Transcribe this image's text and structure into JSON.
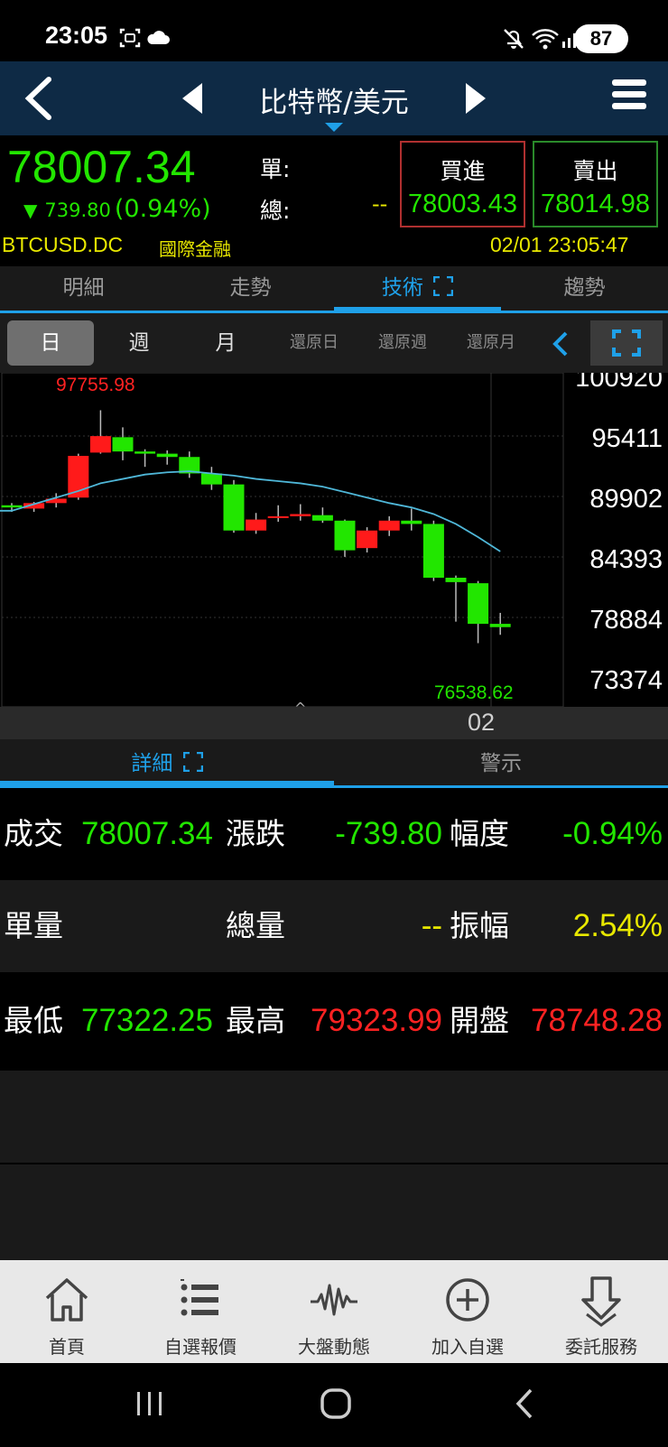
{
  "status_bar": {
    "time": "23:05",
    "battery": "87"
  },
  "header": {
    "title": "比特幣/美元"
  },
  "quote": {
    "last_price": "78007.34",
    "change_amount": "739.80",
    "change_percent": "(0.94%)",
    "unit_label": "單:",
    "total_label": "總:",
    "total_value": "--",
    "buy_label": "買進",
    "buy_price": "78003.43",
    "sell_label": "賣出",
    "sell_price": "78014.98",
    "symbol": "BTCUSD.DC",
    "exchange": "國際金融",
    "datetime": "02/01 23:05:47"
  },
  "tabs": [
    "明細",
    "走勢",
    "技術",
    "趨勢"
  ],
  "periods": [
    "日",
    "週",
    "月",
    "還原日",
    "還原週",
    "還原月"
  ],
  "chart_data": {
    "type": "candlestick",
    "y_ticks": [
      100920,
      95411,
      89902,
      84393,
      78884,
      73374
    ],
    "ylim": [
      73374,
      100920
    ],
    "high_label": "97755.98",
    "low_label": "76538.62",
    "x_label": "02",
    "candles": [
      {
        "o": 88900,
        "h": 89300,
        "l": 88500,
        "c": 89100,
        "color": "green"
      },
      {
        "o": 88800,
        "h": 89400,
        "l": 88500,
        "c": 89300,
        "color": "red"
      },
      {
        "o": 89300,
        "h": 90200,
        "l": 88900,
        "c": 89700,
        "color": "red"
      },
      {
        "o": 89800,
        "h": 93800,
        "l": 89600,
        "c": 93600,
        "color": "red"
      },
      {
        "o": 93900,
        "h": 97756,
        "l": 93800,
        "c": 95400,
        "color": "red"
      },
      {
        "o": 95300,
        "h": 96200,
        "l": 93200,
        "c": 94000,
        "color": "green"
      },
      {
        "o": 94000,
        "h": 94200,
        "l": 92600,
        "c": 93800,
        "color": "green"
      },
      {
        "o": 93800,
        "h": 94100,
        "l": 92800,
        "c": 93500,
        "color": "green"
      },
      {
        "o": 93500,
        "h": 94000,
        "l": 91600,
        "c": 92000,
        "color": "green"
      },
      {
        "o": 92000,
        "h": 92600,
        "l": 90500,
        "c": 91000,
        "color": "green"
      },
      {
        "o": 91000,
        "h": 91400,
        "l": 86600,
        "c": 86800,
        "color": "green"
      },
      {
        "o": 86800,
        "h": 88400,
        "l": 86500,
        "c": 87800,
        "color": "red"
      },
      {
        "o": 88000,
        "h": 89100,
        "l": 87600,
        "c": 88100,
        "color": "red"
      },
      {
        "o": 88100,
        "h": 89200,
        "l": 87700,
        "c": 88300,
        "color": "red"
      },
      {
        "o": 88200,
        "h": 88900,
        "l": 87500,
        "c": 87700,
        "color": "green"
      },
      {
        "o": 87700,
        "h": 87800,
        "l": 84400,
        "c": 85000,
        "color": "green"
      },
      {
        "o": 85200,
        "h": 87100,
        "l": 84800,
        "c": 86800,
        "color": "red"
      },
      {
        "o": 86800,
        "h": 88100,
        "l": 86300,
        "c": 87700,
        "color": "red"
      },
      {
        "o": 87700,
        "h": 88800,
        "l": 86800,
        "c": 87400,
        "color": "green"
      },
      {
        "o": 87400,
        "h": 87700,
        "l": 82200,
        "c": 82500,
        "color": "green"
      },
      {
        "o": 82500,
        "h": 82700,
        "l": 78500,
        "c": 82100,
        "color": "green"
      },
      {
        "o": 82000,
        "h": 82200,
        "l": 76539,
        "c": 78300,
        "color": "green"
      },
      {
        "o": 78300,
        "h": 79300,
        "l": 77300,
        "c": 78000,
        "color": "green"
      }
    ],
    "ma_line": [
      88600,
      89200,
      89800,
      90400,
      91100,
      91500,
      91900,
      92100,
      92200,
      92000,
      91800,
      91500,
      91300,
      91100,
      90800,
      90300,
      89800,
      89300,
      88900,
      88300,
      87400,
      86200,
      84900
    ],
    "colors": {
      "up": "#ff1a1a",
      "down": "#22e600",
      "ma": "#4fb7d8"
    }
  },
  "detail_tabs": [
    "詳細",
    "警示"
  ],
  "details": {
    "r1": {
      "l1": "成交",
      "v1": "78007.34",
      "l2": "漲跌",
      "v2": "-739.80",
      "l3": "幅度",
      "v3": "-0.94%"
    },
    "r2": {
      "l1": "單量",
      "l2": "總量",
      "v2": "--",
      "l3": "振幅",
      "v3": "2.54%"
    },
    "r3": {
      "l1": "最低",
      "v1": "77322.25",
      "l2": "最高",
      "v2": "79323.99",
      "l3": "開盤",
      "v3": "78748.28"
    }
  },
  "bottom_nav": [
    "首頁",
    "自選報價",
    "大盤動態",
    "加入自選",
    "委託服務"
  ]
}
